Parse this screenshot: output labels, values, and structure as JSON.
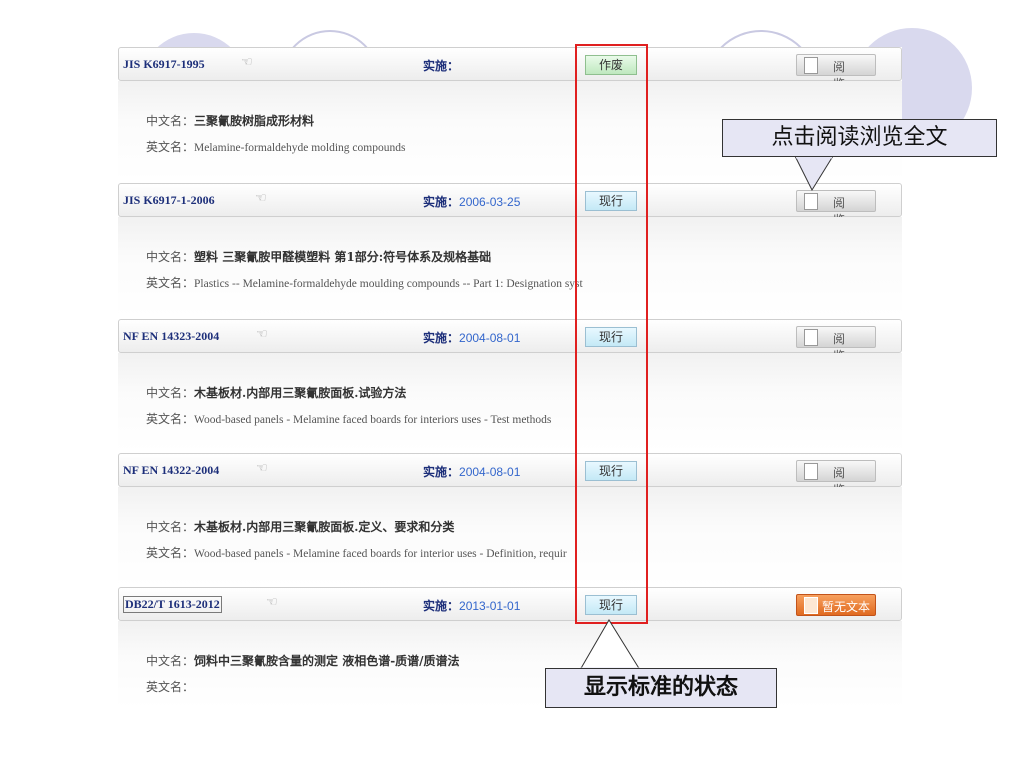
{
  "columns": {
    "impl_label": "实施："
  },
  "labels": {
    "cn": "中文名：",
    "en": "英文名："
  },
  "records": [
    {
      "code": "JIS K6917-1995",
      "date": "",
      "status": "作废",
      "status_type": "obsolete",
      "action": "阅 览",
      "action_type": "read",
      "cn_name": "三聚氰胺树脂成形材料",
      "en_name": "Melamine-formaldehyde molding compounds"
    },
    {
      "code": "JIS K6917-1-2006",
      "date": "2006-03-25",
      "status": "现行",
      "status_type": "current",
      "action": "阅 览",
      "action_type": "read",
      "cn_name": "塑料 三聚氰胺甲醛模塑料 第1部分:符号体系及规格基础",
      "en_name": "Plastics -- Melamine-formaldehyde moulding compounds -- Part 1: Designation syst"
    },
    {
      "code": "NF EN 14323-2004",
      "date": "2004-08-01",
      "status": "现行",
      "status_type": "current",
      "action": "阅 览",
      "action_type": "read",
      "cn_name": "木基板材.内部用三聚氰胺面板.试验方法",
      "en_name": "Wood-based panels - Melamine faced boards for interiors uses - Test methods"
    },
    {
      "code": "NF EN 14322-2004",
      "date": "2004-08-01",
      "status": "现行",
      "status_type": "current",
      "action": "阅 览",
      "action_type": "read",
      "cn_name": "木基板材.内部用三聚氰胺面板.定义、要求和分类",
      "en_name": "Wood-based panels - Melamine faced boards for interior uses - Definition, requir"
    },
    {
      "code": "DB22/T 1613-2012",
      "date": "2013-01-01",
      "status": "现行",
      "status_type": "current",
      "action": "暂无文本",
      "action_type": "none",
      "cn_name": "饲料中三聚氰胺含量的测定 液相色谱-质谱/质谱法",
      "en_name": ""
    }
  ],
  "annotations": {
    "read_callout": "点击阅读浏览全文",
    "status_callout": "显示标准的状态"
  },
  "colors": {
    "highlight": "#e02020",
    "callout_bg": "#e6e6f4",
    "code_text": "#1d2f7a",
    "date_text": "#3366cc",
    "no_text_button": "#e06a20"
  }
}
